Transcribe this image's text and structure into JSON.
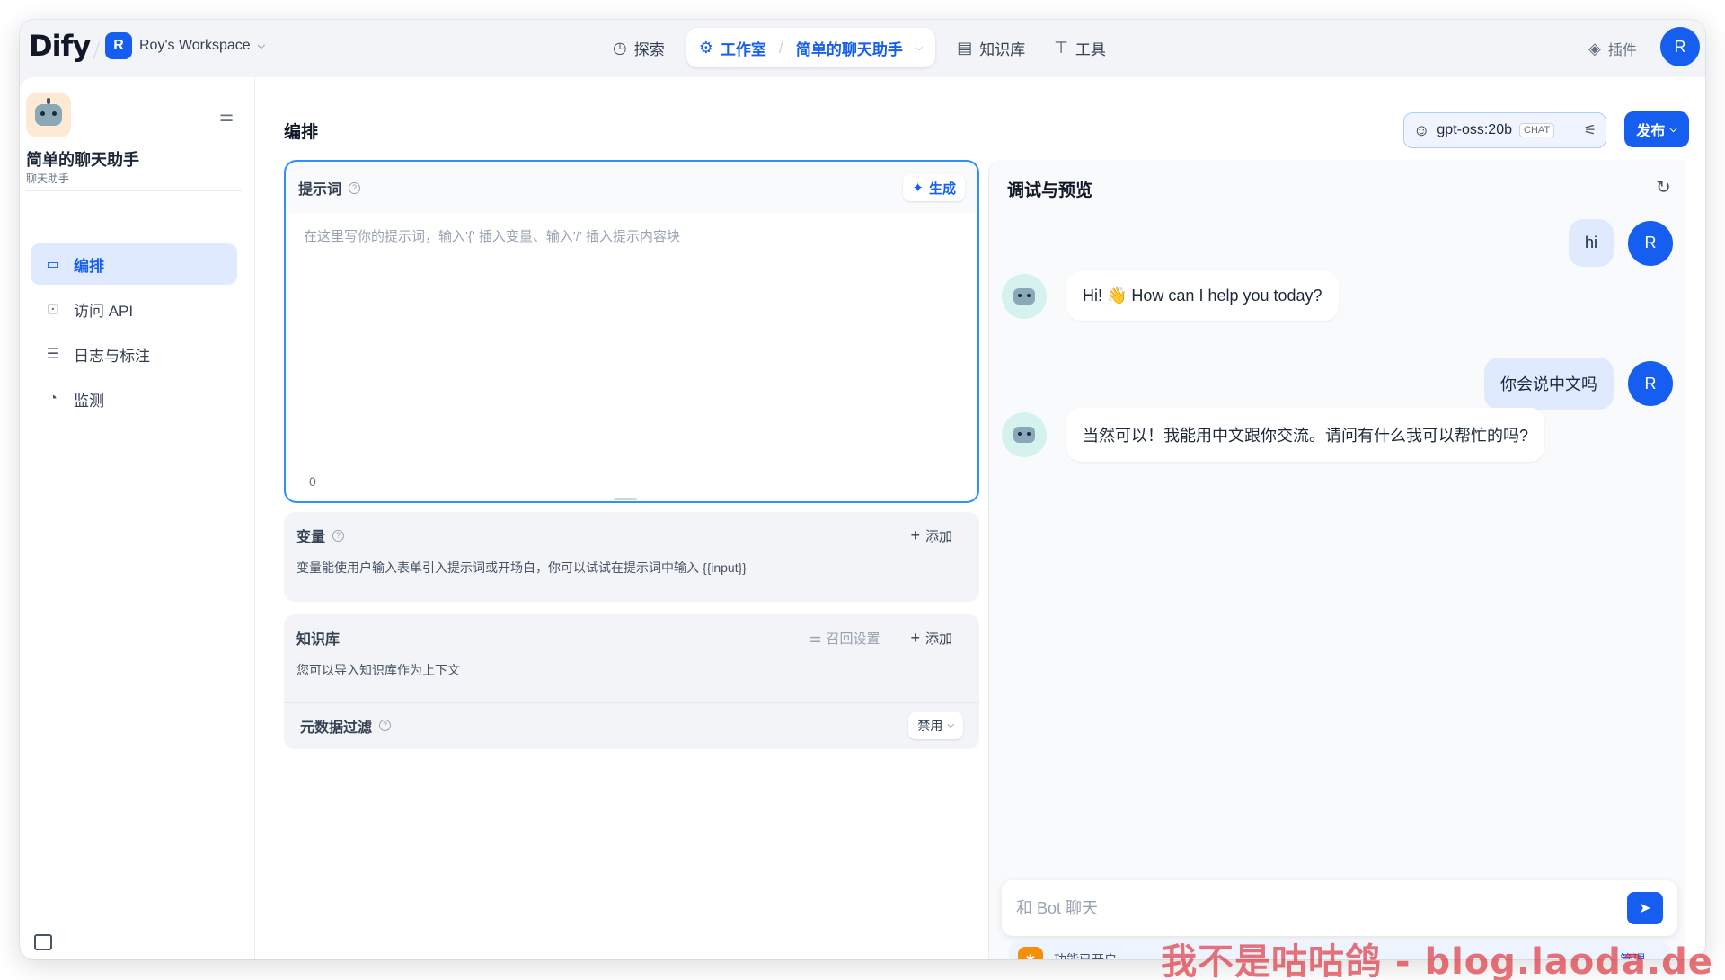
{
  "header": {
    "logo": "Dify",
    "workspace_initial": "R",
    "workspace_name": "Roy's Workspace",
    "nav": {
      "explore": "探索",
      "studio": "工作室",
      "current_app": "简单的聊天助手",
      "knowledge": "知识库",
      "tools": "工具"
    },
    "plugins": "插件",
    "user_initial": "R"
  },
  "sidebar": {
    "app_title": "简单的聊天助手",
    "app_type": "聊天助手",
    "items": [
      {
        "label": "编排",
        "icon": "orchestrate-icon",
        "active": true
      },
      {
        "label": "访问 API",
        "icon": "terminal-icon",
        "active": false
      },
      {
        "label": "日志与标注",
        "icon": "logs-icon",
        "active": false
      },
      {
        "label": "监测",
        "icon": "monitor-icon",
        "active": false
      }
    ]
  },
  "main": {
    "title": "编排",
    "model": {
      "name": "gpt-oss:20b",
      "badge": "CHAT"
    },
    "publish": "发布",
    "prompt": {
      "title": "提示词",
      "generate": "生成",
      "placeholder": "在这里写你的提示词，输入'{' 插入变量、输入'/' 插入提示内容块",
      "count": "0"
    },
    "variables": {
      "title": "变量",
      "add": "添加",
      "desc": "变量能使用户输入表单引入提示词或开场白，你可以试试在提示词中输入 {{input}}"
    },
    "knowledge": {
      "title": "知识库",
      "recall": "召回设置",
      "add": "添加",
      "desc": "您可以导入知识库作为上下文",
      "metadata_filter": "元数据过滤",
      "metadata_value": "禁用"
    }
  },
  "debug": {
    "title": "调试与预览",
    "messages": [
      {
        "role": "user",
        "text": "hi"
      },
      {
        "role": "bot",
        "text": "Hi! 👋 How can I help you today?"
      },
      {
        "role": "user",
        "text": "你会说中文吗"
      },
      {
        "role": "bot",
        "text": "当然可以！我能用中文跟你交流。请问有什么我可以帮忙的吗?"
      }
    ],
    "input_placeholder": "和 Bot 聊天",
    "features_enabled": "功能已开启",
    "manage": "管理"
  },
  "watermark": "我不是咕咕鸽 - blog.laoda.de",
  "colors": {
    "accent": "#155eef",
    "prompt_border": "#2e90fa",
    "watermark": "#dc1e28"
  }
}
